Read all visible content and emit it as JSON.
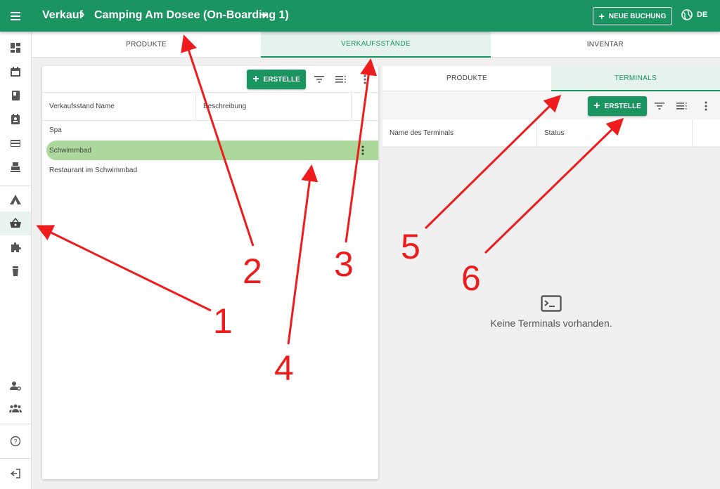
{
  "header": {
    "breadcrumb_root": "Verkauf",
    "breadcrumb_separator": "›",
    "breadcrumb_current": "Camping Am Dosee (On-Boarding 1)",
    "new_booking": "NEUE BUCHUNG",
    "language": "DE",
    "bar_color": "#1a9460"
  },
  "sidebar": {
    "items": [
      {
        "icon": "dashboard-icon"
      },
      {
        "icon": "calendar-icon"
      },
      {
        "icon": "book-icon"
      },
      {
        "icon": "contact-book-icon"
      },
      {
        "icon": "credit-card-icon"
      },
      {
        "icon": "cash-register-icon"
      },
      {
        "icon": "tent-icon"
      },
      {
        "icon": "basket-icon",
        "active": true
      },
      {
        "icon": "puzzle-icon"
      },
      {
        "icon": "bottle-icon"
      },
      {
        "icon": "user-settings-icon"
      },
      {
        "icon": "group-icon"
      },
      {
        "icon": "help-icon"
      },
      {
        "icon": "logout-icon"
      }
    ]
  },
  "main_tabs": [
    {
      "label": "PRODUKTE"
    },
    {
      "label": "VERKAUFSSTÄNDE",
      "active": true
    },
    {
      "label": "INVENTAR"
    }
  ],
  "stands": {
    "create_label": "ERSTELLE",
    "columns": [
      "Verkaufsstand Name",
      "Beschreibung"
    ],
    "rows": [
      {
        "name": "Spa"
      },
      {
        "name": "Schwimmbad",
        "selected": true
      },
      {
        "name": "Restaurant im Schwimmbad"
      }
    ]
  },
  "detail": {
    "tabs": [
      {
        "label": "PRODUKTE"
      },
      {
        "label": "TERMINALS",
        "active": true
      }
    ],
    "create_label": "ERSTELLE",
    "columns": [
      "Name des Terminals",
      "Status"
    ],
    "empty_text": "Keine Terminals vorhanden."
  },
  "annotations": {
    "color": "#ee1c1c",
    "labels": [
      "1",
      "2",
      "3",
      "4",
      "5",
      "6"
    ]
  }
}
